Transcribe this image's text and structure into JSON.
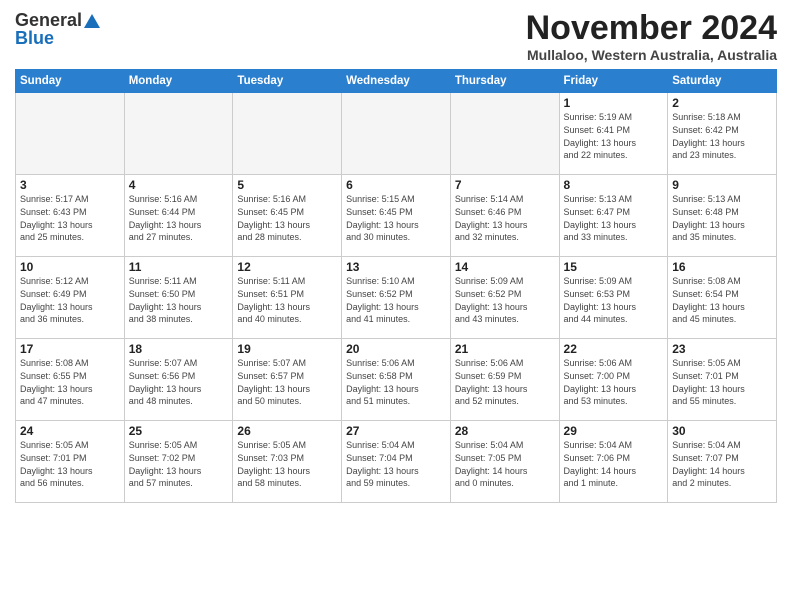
{
  "logo": {
    "general": "General",
    "blue": "Blue"
  },
  "title": "November 2024",
  "location": "Mullaloo, Western Australia, Australia",
  "headers": [
    "Sunday",
    "Monday",
    "Tuesday",
    "Wednesday",
    "Thursday",
    "Friday",
    "Saturday"
  ],
  "weeks": [
    [
      {
        "day": "",
        "info": ""
      },
      {
        "day": "",
        "info": ""
      },
      {
        "day": "",
        "info": ""
      },
      {
        "day": "",
        "info": ""
      },
      {
        "day": "",
        "info": ""
      },
      {
        "day": "1",
        "info": "Sunrise: 5:19 AM\nSunset: 6:41 PM\nDaylight: 13 hours\nand 22 minutes."
      },
      {
        "day": "2",
        "info": "Sunrise: 5:18 AM\nSunset: 6:42 PM\nDaylight: 13 hours\nand 23 minutes."
      }
    ],
    [
      {
        "day": "3",
        "info": "Sunrise: 5:17 AM\nSunset: 6:43 PM\nDaylight: 13 hours\nand 25 minutes."
      },
      {
        "day": "4",
        "info": "Sunrise: 5:16 AM\nSunset: 6:44 PM\nDaylight: 13 hours\nand 27 minutes."
      },
      {
        "day": "5",
        "info": "Sunrise: 5:16 AM\nSunset: 6:45 PM\nDaylight: 13 hours\nand 28 minutes."
      },
      {
        "day": "6",
        "info": "Sunrise: 5:15 AM\nSunset: 6:45 PM\nDaylight: 13 hours\nand 30 minutes."
      },
      {
        "day": "7",
        "info": "Sunrise: 5:14 AM\nSunset: 6:46 PM\nDaylight: 13 hours\nand 32 minutes."
      },
      {
        "day": "8",
        "info": "Sunrise: 5:13 AM\nSunset: 6:47 PM\nDaylight: 13 hours\nand 33 minutes."
      },
      {
        "day": "9",
        "info": "Sunrise: 5:13 AM\nSunset: 6:48 PM\nDaylight: 13 hours\nand 35 minutes."
      }
    ],
    [
      {
        "day": "10",
        "info": "Sunrise: 5:12 AM\nSunset: 6:49 PM\nDaylight: 13 hours\nand 36 minutes."
      },
      {
        "day": "11",
        "info": "Sunrise: 5:11 AM\nSunset: 6:50 PM\nDaylight: 13 hours\nand 38 minutes."
      },
      {
        "day": "12",
        "info": "Sunrise: 5:11 AM\nSunset: 6:51 PM\nDaylight: 13 hours\nand 40 minutes."
      },
      {
        "day": "13",
        "info": "Sunrise: 5:10 AM\nSunset: 6:52 PM\nDaylight: 13 hours\nand 41 minutes."
      },
      {
        "day": "14",
        "info": "Sunrise: 5:09 AM\nSunset: 6:52 PM\nDaylight: 13 hours\nand 43 minutes."
      },
      {
        "day": "15",
        "info": "Sunrise: 5:09 AM\nSunset: 6:53 PM\nDaylight: 13 hours\nand 44 minutes."
      },
      {
        "day": "16",
        "info": "Sunrise: 5:08 AM\nSunset: 6:54 PM\nDaylight: 13 hours\nand 45 minutes."
      }
    ],
    [
      {
        "day": "17",
        "info": "Sunrise: 5:08 AM\nSunset: 6:55 PM\nDaylight: 13 hours\nand 47 minutes."
      },
      {
        "day": "18",
        "info": "Sunrise: 5:07 AM\nSunset: 6:56 PM\nDaylight: 13 hours\nand 48 minutes."
      },
      {
        "day": "19",
        "info": "Sunrise: 5:07 AM\nSunset: 6:57 PM\nDaylight: 13 hours\nand 50 minutes."
      },
      {
        "day": "20",
        "info": "Sunrise: 5:06 AM\nSunset: 6:58 PM\nDaylight: 13 hours\nand 51 minutes."
      },
      {
        "day": "21",
        "info": "Sunrise: 5:06 AM\nSunset: 6:59 PM\nDaylight: 13 hours\nand 52 minutes."
      },
      {
        "day": "22",
        "info": "Sunrise: 5:06 AM\nSunset: 7:00 PM\nDaylight: 13 hours\nand 53 minutes."
      },
      {
        "day": "23",
        "info": "Sunrise: 5:05 AM\nSunset: 7:01 PM\nDaylight: 13 hours\nand 55 minutes."
      }
    ],
    [
      {
        "day": "24",
        "info": "Sunrise: 5:05 AM\nSunset: 7:01 PM\nDaylight: 13 hours\nand 56 minutes."
      },
      {
        "day": "25",
        "info": "Sunrise: 5:05 AM\nSunset: 7:02 PM\nDaylight: 13 hours\nand 57 minutes."
      },
      {
        "day": "26",
        "info": "Sunrise: 5:05 AM\nSunset: 7:03 PM\nDaylight: 13 hours\nand 58 minutes."
      },
      {
        "day": "27",
        "info": "Sunrise: 5:04 AM\nSunset: 7:04 PM\nDaylight: 13 hours\nand 59 minutes."
      },
      {
        "day": "28",
        "info": "Sunrise: 5:04 AM\nSunset: 7:05 PM\nDaylight: 14 hours\nand 0 minutes."
      },
      {
        "day": "29",
        "info": "Sunrise: 5:04 AM\nSunset: 7:06 PM\nDaylight: 14 hours\nand 1 minute."
      },
      {
        "day": "30",
        "info": "Sunrise: 5:04 AM\nSunset: 7:07 PM\nDaylight: 14 hours\nand 2 minutes."
      }
    ]
  ]
}
